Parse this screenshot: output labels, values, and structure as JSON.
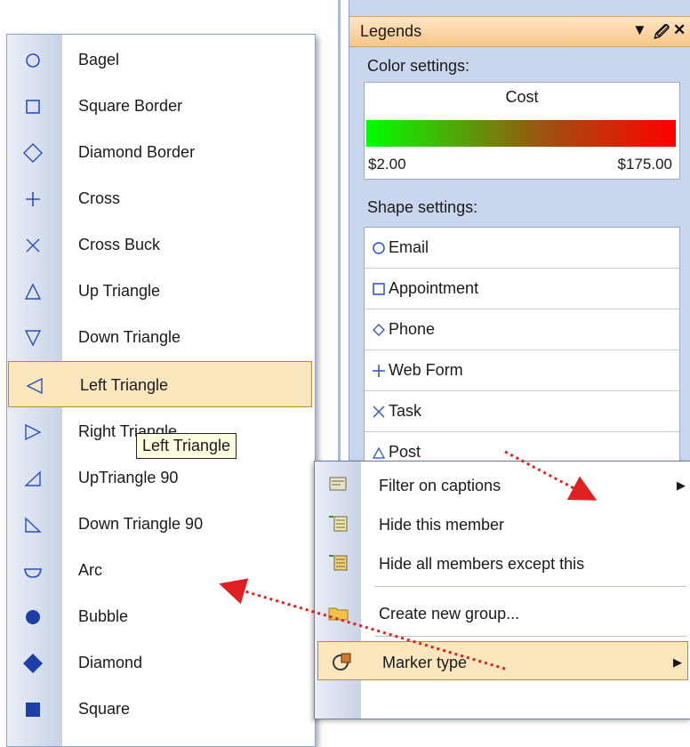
{
  "legends_panel": {
    "title": "Legends",
    "color_settings_label": "Color settings:",
    "color_scale": {
      "title": "Cost",
      "min_label": "$2.00",
      "max_label": "$175.00",
      "gradient_colors": [
        "#00ff00",
        "#a05010",
        "#ff0000"
      ]
    },
    "shape_settings_label": "Shape settings:",
    "shape_items": [
      {
        "label": "Email",
        "icon": "circle-outline-icon"
      },
      {
        "label": "Appointment",
        "icon": "square-outline-icon"
      },
      {
        "label": "Phone",
        "icon": "diamond-outline-icon"
      },
      {
        "label": "Web Form",
        "icon": "cross-icon"
      },
      {
        "label": "Task",
        "icon": "cross-buck-icon"
      },
      {
        "label": "Post",
        "icon": "up-triangle-icon"
      }
    ]
  },
  "marker_menu": {
    "items": [
      {
        "label": "Bagel",
        "icon": "circle-outline-icon"
      },
      {
        "label": "Square Border",
        "icon": "square-outline-icon"
      },
      {
        "label": "Diamond Border",
        "icon": "diamond-outline-icon"
      },
      {
        "label": "Cross",
        "icon": "cross-icon"
      },
      {
        "label": "Cross Buck",
        "icon": "cross-buck-icon"
      },
      {
        "label": "Up Triangle",
        "icon": "up-triangle-icon"
      },
      {
        "label": "Down Triangle",
        "icon": "down-triangle-icon"
      },
      {
        "label": "Left Triangle",
        "icon": "left-triangle-icon"
      },
      {
        "label": "Right Triangle",
        "icon": "right-triangle-icon"
      },
      {
        "label": "UpTriangle 90",
        "icon": "up-triangle-90-icon"
      },
      {
        "label": "Down Triangle 90",
        "icon": "down-triangle-90-icon"
      },
      {
        "label": "Arc",
        "icon": "arc-icon"
      },
      {
        "label": "Bubble",
        "icon": "bubble-icon"
      },
      {
        "label": "Diamond",
        "icon": "diamond-filled-icon"
      },
      {
        "label": "Square",
        "icon": "square-filled-icon"
      }
    ],
    "selected_label": "Left Triangle",
    "tooltip": "Left Triangle"
  },
  "context_menu": {
    "items": [
      {
        "label": "Filter on captions",
        "has_submenu": true
      },
      {
        "label": "Hide this member",
        "has_submenu": false
      },
      {
        "label": "Hide all members except this",
        "has_submenu": false
      },
      {
        "label": "Create new group...",
        "has_submenu": false
      },
      {
        "label": "Marker type",
        "has_submenu": true
      }
    ]
  },
  "colors": {
    "accent_blue": "#2a4fc0",
    "highlight": "#fbe6bd",
    "annotation_arrow": "#e02020"
  }
}
